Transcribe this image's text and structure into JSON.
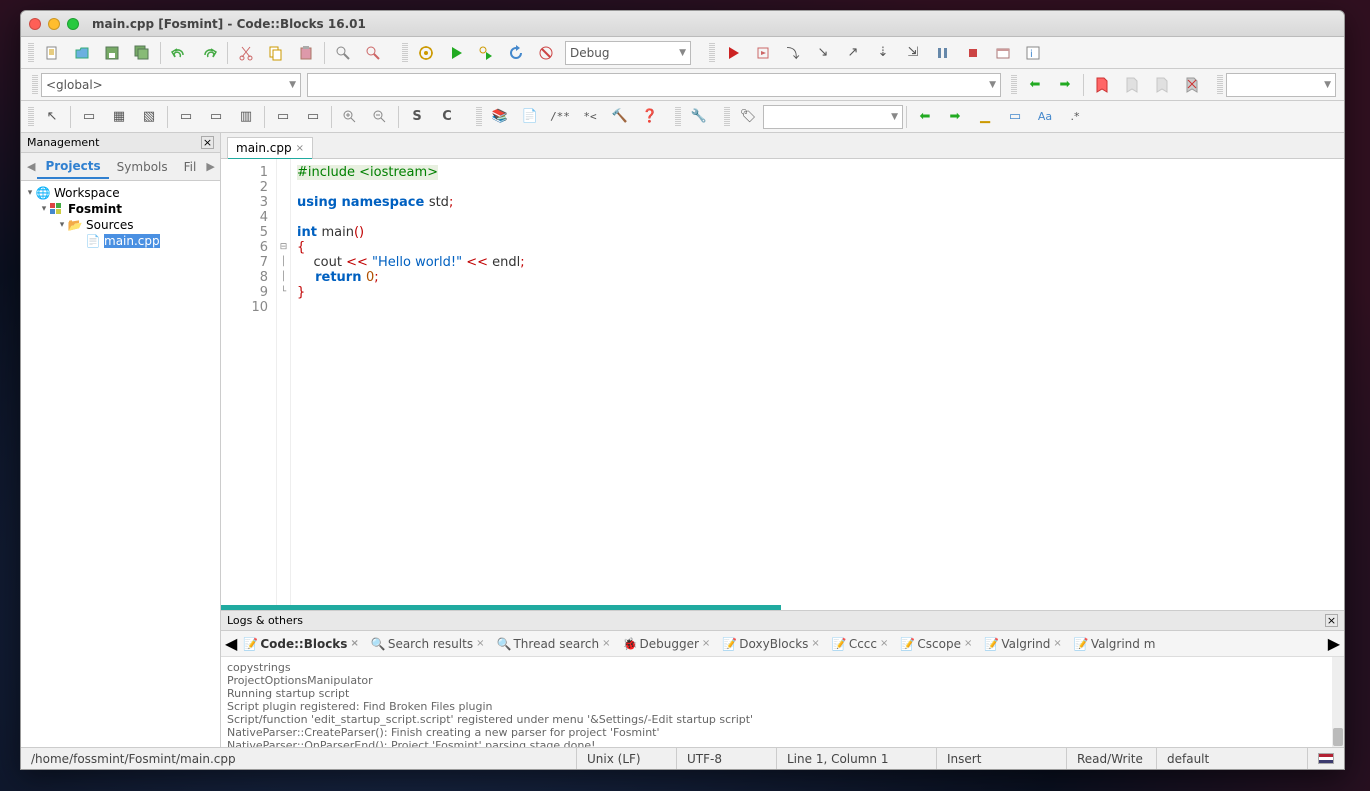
{
  "title": "main.cpp [Fosmint] - Code::Blocks 16.01",
  "combo_global": "<global>",
  "combo_target": "Debug",
  "sidebar": {
    "header": "Management",
    "tabs": [
      "Projects",
      "Symbols",
      "Fil"
    ],
    "workspace": "Workspace",
    "project": "Fosmint",
    "folder": "Sources",
    "file": "main.cpp"
  },
  "editor_tab": "main.cpp",
  "code_lines": [
    "1",
    "2",
    "3",
    "4",
    "5",
    "6",
    "7",
    "8",
    "9",
    "10"
  ],
  "code": {
    "l1a": "#include ",
    "l1b": "<iostream>",
    "l3a": "using ",
    "l3b": "namespace ",
    "l3c": "std",
    "l3d": ";",
    "l5a": "int ",
    "l5b": "main",
    "l5c": "()",
    "l6": "{",
    "l7a": "    cout ",
    "l7b": "<< ",
    "l7c": "\"Hello world!\"",
    "l7d": " << ",
    "l7e": "endl",
    "l7f": ";",
    "l8a": "    return ",
    "l8b": "0",
    "l8c": ";",
    "l9": "}"
  },
  "bottom_header": "Logs & others",
  "bottom_tabs": [
    "Code::Blocks",
    "Search results",
    "Thread search",
    "Debugger",
    "DoxyBlocks",
    "Cccc",
    "Cscope",
    "Valgrind",
    "Valgrind m"
  ],
  "log_lines": [
    "copystrings",
    "ProjectOptionsManipulator",
    "Running startup script",
    "Script plugin registered: Find Broken Files plugin",
    "Script/function 'edit_startup_script.script' registered under menu '&Settings/-Edit startup script'",
    "NativeParser::CreateParser(): Finish creating a new parser for project 'Fosmint'",
    "NativeParser::OnParserEnd(): Project 'Fosmint' parsing stage done!"
  ],
  "status": {
    "path": "/home/fossmint/Fosmint/main.cpp",
    "eol": "Unix (LF)",
    "enc": "UTF-8",
    "pos": "Line 1, Column 1",
    "ins": "Insert",
    "rw": "Read/Write",
    "prof": "default"
  }
}
